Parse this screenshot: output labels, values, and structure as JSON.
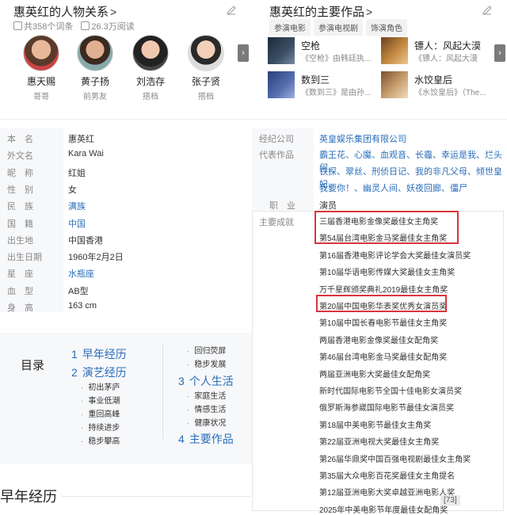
{
  "relations": {
    "title": "惠英红的人物关系",
    "meta_entries": "共358个词条",
    "meta_views": "26.3万阅读",
    "people": [
      {
        "name": "惠天赐",
        "role": "哥哥"
      },
      {
        "name": "黄子扬",
        "role": "前男友"
      },
      {
        "name": "刘浩存",
        "role": "搭档"
      },
      {
        "name": "张子贤",
        "role": "搭档"
      }
    ]
  },
  "works": {
    "title": "惠英红的主要作品",
    "tabs": [
      "参演电影",
      "参演电视剧",
      "饰演角色"
    ],
    "items": [
      {
        "title": "空枪",
        "desc": "《空枪》由韩廷执..."
      },
      {
        "title": "镖人：风起大漠",
        "desc": "《镖人：风起大漠"
      },
      {
        "title": "数到三",
        "desc": "《数到三》是由孙..."
      },
      {
        "title": "水饺皇后",
        "desc": "《水饺皇后》（The..."
      }
    ]
  },
  "info_left": [
    {
      "label": "本　名",
      "value": "惠英红",
      "link": false
    },
    {
      "label": "外文名",
      "value": "Kara Wai",
      "link": false
    },
    {
      "label": "昵　称",
      "value": "红姐",
      "link": false
    },
    {
      "label": "性　别",
      "value": "女",
      "link": false
    },
    {
      "label": "民　族",
      "value": "满族",
      "link": true
    },
    {
      "label": "国　籍",
      "value": "中国",
      "link": true
    },
    {
      "label": "出生地",
      "value": "中国香港",
      "link": false
    },
    {
      "label": "出生日期",
      "value": "1960年2月2日",
      "link": false
    },
    {
      "label": "星　座",
      "value": "水瓶座",
      "link": true
    },
    {
      "label": "血　型",
      "value": "AB型",
      "link": false
    },
    {
      "label": "身　高",
      "value": "163 cm",
      "link": false
    }
  ],
  "info_right": {
    "agency_label": "经纪公司",
    "agency_value": "英皇娱乐集团有限公司",
    "works_label": "代表作品",
    "works_lines": [
      "霸王花、心魔、血观音、长霾、幸运是我、烂头何、",
      "铁探、翠丝、刑侦日记、我的非凡父母、倾世皇妃、",
      "我要你！、幽灵人间、妖夜回廊、僵尸"
    ],
    "job_label": "职　业",
    "job_value": "演员",
    "achv_label": "主要成就"
  },
  "achievements": [
    "三届香港电影金像奖最佳女主角奖",
    "第54届台湾电影金马奖最佳女主角奖",
    "第16届香港电影评论学会大奖最佳女演员奖",
    "第10届华语电影传媒大奖最佳女主角奖",
    "万千星辉颁奖典礼2019最佳女主角奖",
    "第20届中国电影华表奖优秀女演员奖",
    "第10届中国长春电影节最佳女主角奖",
    "两届香港电影金像奖最佳女配角奖",
    "第46届台湾电影金马奖最佳女配角奖",
    "两届亚洲电影大奖最佳女配角奖",
    "新时代国际电影节全国十佳电影女演员奖",
    "俄罗斯海参崴国际电影节最佳女演员奖",
    "第18届中美电影节最佳女主角奖",
    "第22届亚洲电视大奖最佳女主角奖",
    "第26届华鼎奖中国百强电视剧最佳女主角奖",
    "第35届大众电影百花奖最佳女主角提名",
    "第12届亚洲电影大奖卓越亚洲电影人奖",
    "2025年中美电影节年度最佳女配角奖"
  ],
  "achv_badge": "[73]",
  "toc": {
    "title": "目录",
    "col1": [
      {
        "num": "1",
        "label": "早年经历",
        "subs": []
      },
      {
        "num": "2",
        "label": "演艺经历",
        "subs": [
          "初出茅庐",
          "事业低潮",
          "重回高峰",
          "持续进步",
          "稳步攀高"
        ]
      }
    ],
    "col2_subs_top": [
      "回归荧屏",
      "稳步发展"
    ],
    "col2": [
      {
        "num": "3",
        "label": "个人生活",
        "subs": [
          "家庭生活",
          "情感生活",
          "健康状况"
        ]
      },
      {
        "num": "4",
        "label": "主要作品",
        "subs": []
      }
    ]
  },
  "section_title": "早年经历",
  "colors": {
    "link": "#2a6ebb",
    "highlight": "#d9363e"
  }
}
